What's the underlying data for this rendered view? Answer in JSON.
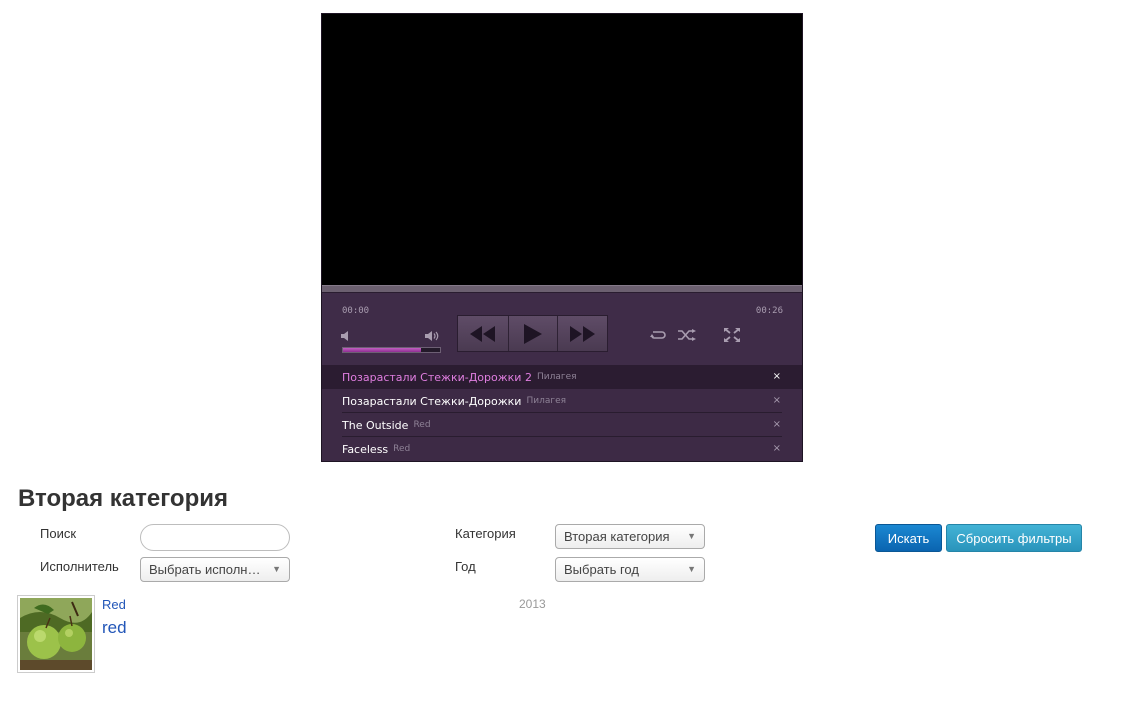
{
  "player": {
    "current_time": "00:00",
    "duration": "00:26",
    "volume_level": 0.8,
    "accent_color": "#c45fc4",
    "icons": {
      "volume_low": "speaker-low-icon",
      "volume_high": "speaker-high-icon",
      "rewind": "rewind-icon",
      "play": "play-icon",
      "forward": "fast-forward-icon",
      "repeat": "repeat-icon",
      "shuffle": "shuffle-icon",
      "fullscreen": "fullscreen-icon",
      "remove": "close-icon"
    }
  },
  "playlist": [
    {
      "title": "Позарастали Стежки-Дорожки 2",
      "artist": "Пилагея",
      "active": true
    },
    {
      "title": "Позарастали Стежки-Дорожки",
      "artist": "Пилагея",
      "active": false
    },
    {
      "title": "The Outside",
      "artist": "Red",
      "active": false
    },
    {
      "title": "Faceless",
      "artist": "Red",
      "active": false
    }
  ],
  "playlist_remove_glyph": "×",
  "category_title": "Вторая категория",
  "filters": {
    "search_label": "Поиск",
    "search_value": "",
    "artist_label": "Исполнитель",
    "artist_selected": "Выбрать исполнителя",
    "category_label": "Категория",
    "category_selected": "Вторая категория",
    "year_label": "Год",
    "year_selected": "Выбрать год",
    "select_arrow": "▼"
  },
  "buttons": {
    "search": "Искать",
    "reset": "Сбросить фильтры"
  },
  "result": {
    "artist": "Red",
    "title": "red",
    "year": "2013"
  }
}
